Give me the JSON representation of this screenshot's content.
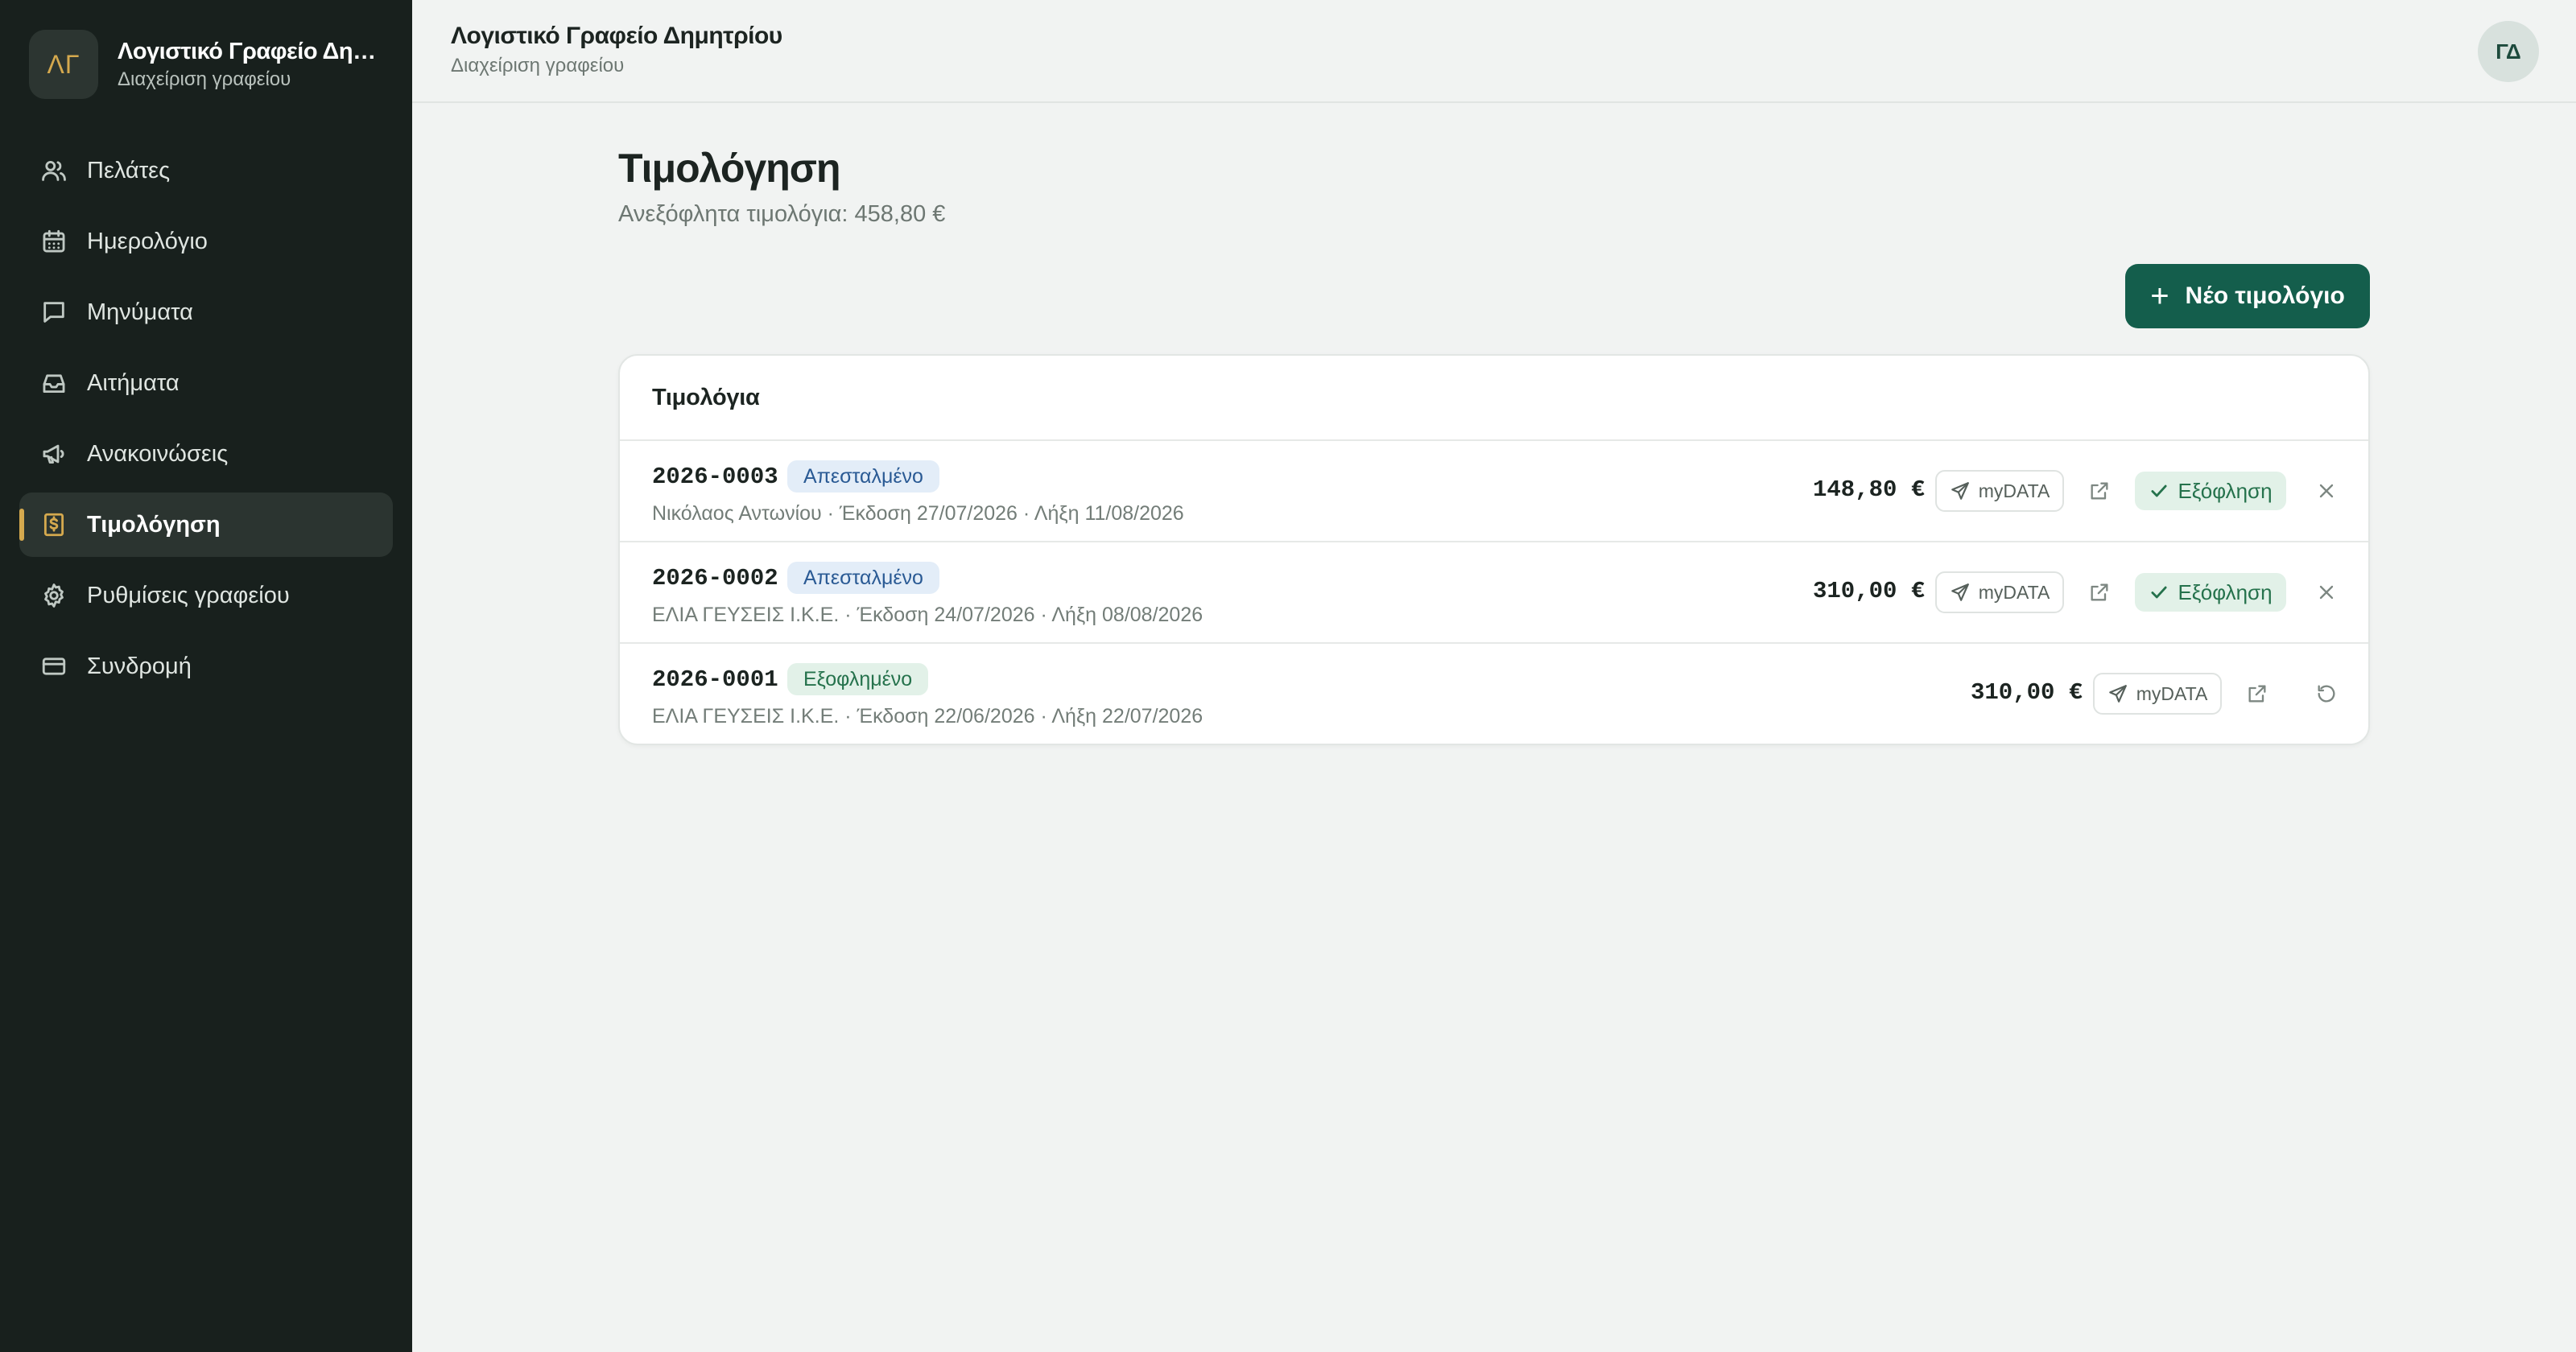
{
  "app": {
    "logo_initials": "ΛΓ",
    "name": "Λογιστικό Γραφείο Δημ...",
    "subtitle": "Διαχείριση γραφείου"
  },
  "sidebar": {
    "items": [
      {
        "label": "Πελάτες",
        "icon": "users-icon"
      },
      {
        "label": "Ημερολόγιο",
        "icon": "calendar-icon"
      },
      {
        "label": "Μηνύματα",
        "icon": "message-icon"
      },
      {
        "label": "Αιτήματα",
        "icon": "inbox-icon"
      },
      {
        "label": "Ανακοινώσεις",
        "icon": "megaphone-icon"
      },
      {
        "label": "Τιμολόγηση",
        "icon": "invoice-icon",
        "active": true
      },
      {
        "label": "Ρυθμίσεις γραφείου",
        "icon": "gear-icon"
      },
      {
        "label": "Συνδρομή",
        "icon": "credit-card-icon"
      }
    ]
  },
  "header": {
    "title": "Λογιστικό Γραφείο Δημητρίου",
    "subtitle": "Διαχείριση γραφείου",
    "avatar_initials": "ΓΔ"
  },
  "main": {
    "title": "Τιμολόγηση",
    "subtitle": "Ανεξόφλητα τιμολόγια: 458,80 €",
    "new_button_label": "Νέο τιμολόγιο",
    "card_title": "Τιμολόγια",
    "mydata_label": "myDATA",
    "settle_label": "Εξόφληση",
    "invoices": [
      {
        "number": "2026-0003",
        "status": "Απεσταλμένο",
        "meta": "Νικόλαος Αντωνίου · Έκδοση 27/07/2026 · Λήξη 11/08/2026",
        "amount": "148,80 €"
      },
      {
        "number": "2026-0002",
        "status": "Απεσταλμένο",
        "meta": "ΕΛΙΑ ΓΕΥΣΕΙΣ Ι.Κ.Ε. · Έκδοση 24/07/2026 · Λήξη 08/08/2026",
        "amount": "310,00 €"
      },
      {
        "number": "2026-0001",
        "status": "Εξοφλημένο",
        "meta": "ΕΛΙΑ ΓΕΥΣΕΙΣ Ι.Κ.Ε. · Έκδοση 22/06/2026 · Λήξη 22/07/2026",
        "amount": "310,00 €"
      }
    ]
  },
  "colors": {
    "sidebar_bg": "#18201d",
    "accent": "#d5a94e",
    "primary_button": "#145e4c",
    "sent_badge": "#2a5a94",
    "paid_badge": "#25724c"
  }
}
